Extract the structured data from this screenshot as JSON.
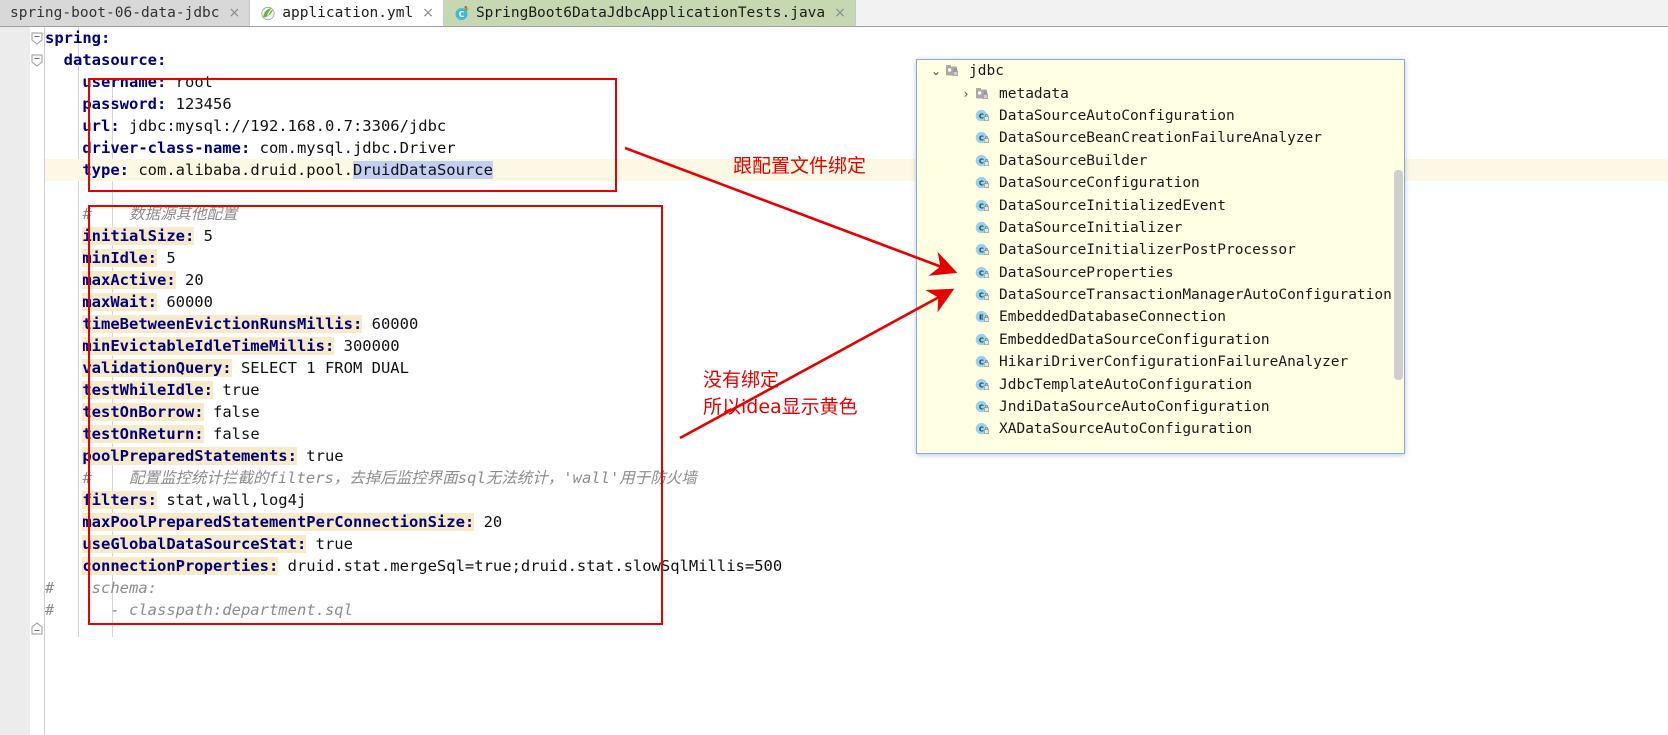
{
  "tabs": [
    {
      "label": "spring-boot-06-data-jdbc",
      "state": "inactive",
      "icon": "none",
      "close": "×"
    },
    {
      "label": "application.yml",
      "state": "plain",
      "icon": "spring-leaf-icon",
      "close": "×"
    },
    {
      "label": "SpringBoot6DataJdbcApplicationTests.java",
      "state": "active",
      "icon": "java-class-icon",
      "close": "×"
    }
  ],
  "editor": {
    "filename": "application.yml",
    "lines": [
      {
        "indent": 0,
        "key": "spring",
        "colon": ":",
        "value": "",
        "type": "key",
        "highlight": false,
        "fold": true
      },
      {
        "indent": 2,
        "key": "datasource",
        "colon": ":",
        "value": "",
        "type": "key",
        "highlight": false,
        "fold": true
      },
      {
        "indent": 4,
        "key": "username",
        "colon": ":",
        "value": " root",
        "type": "key",
        "highlight": false,
        "fold": false
      },
      {
        "indent": 4,
        "key": "password",
        "colon": ":",
        "value": " 123456",
        "type": "key",
        "highlight": false,
        "fold": false
      },
      {
        "indent": 4,
        "key": "url",
        "colon": ":",
        "value": " jdbc:mysql://192.168.0.7:3306/jdbc",
        "type": "key",
        "highlight": false,
        "fold": false
      },
      {
        "indent": 4,
        "key": "driver-class-name",
        "colon": ":",
        "value": " com.mysql.jdbc.Driver",
        "type": "key",
        "highlight": false,
        "fold": false
      },
      {
        "indent": 4,
        "key": "type",
        "colon": ":",
        "value": " com.alibaba.druid.pool.",
        "selected": "DruidDataSource",
        "type": "key",
        "highlight": false,
        "fold": false,
        "currentLine": true
      },
      {
        "indent": 0,
        "key": "",
        "colon": "",
        "value": "",
        "type": "blank",
        "highlight": false,
        "fold": false
      },
      {
        "indent": 4,
        "key": "",
        "colon": "",
        "value": "#    数据源其他配置",
        "type": "comment",
        "highlight": false,
        "fold": false
      },
      {
        "indent": 4,
        "key": "initialSize",
        "colon": ":",
        "value": " 5",
        "type": "key",
        "highlight": true,
        "fold": false
      },
      {
        "indent": 4,
        "key": "minIdle",
        "colon": ":",
        "value": " 5",
        "type": "key",
        "highlight": true,
        "fold": false
      },
      {
        "indent": 4,
        "key": "maxActive",
        "colon": ":",
        "value": " 20",
        "type": "key",
        "highlight": true,
        "fold": false
      },
      {
        "indent": 4,
        "key": "maxWait",
        "colon": ":",
        "value": " 60000",
        "type": "key",
        "highlight": true,
        "fold": false
      },
      {
        "indent": 4,
        "key": "timeBetweenEvictionRunsMillis",
        "colon": ":",
        "value": " 60000",
        "type": "key",
        "highlight": true,
        "fold": false
      },
      {
        "indent": 4,
        "key": "minEvictableIdleTimeMillis",
        "colon": ":",
        "value": " 300000",
        "type": "key",
        "highlight": true,
        "fold": false
      },
      {
        "indent": 4,
        "key": "validationQuery",
        "colon": ":",
        "value": " SELECT 1 FROM DUAL",
        "type": "key",
        "highlight": true,
        "fold": false
      },
      {
        "indent": 4,
        "key": "testWhileIdle",
        "colon": ":",
        "value": " true",
        "type": "key",
        "highlight": true,
        "fold": false
      },
      {
        "indent": 4,
        "key": "testOnBorrow",
        "colon": ":",
        "value": " false",
        "type": "key",
        "highlight": true,
        "fold": false
      },
      {
        "indent": 4,
        "key": "testOnReturn",
        "colon": ":",
        "value": " false",
        "type": "key",
        "highlight": true,
        "fold": false
      },
      {
        "indent": 4,
        "key": "poolPreparedStatements",
        "colon": ":",
        "value": " true",
        "type": "key",
        "highlight": true,
        "fold": false
      },
      {
        "indent": 4,
        "key": "",
        "colon": "",
        "value": "#    配置监控统计拦截的filters，去掉后监控界面sql无法统计，'wall'用于防火墙",
        "type": "comment",
        "highlight": false,
        "fold": false
      },
      {
        "indent": 4,
        "key": "filters",
        "colon": ":",
        "value": " stat,wall,log4j",
        "type": "key",
        "highlight": true,
        "fold": false
      },
      {
        "indent": 4,
        "key": "maxPoolPreparedStatementPerConnectionSize",
        "colon": ":",
        "value": " 20",
        "type": "key",
        "highlight": true,
        "fold": false
      },
      {
        "indent": 4,
        "key": "useGlobalDataSourceStat",
        "colon": ":",
        "value": " true",
        "type": "key",
        "highlight": true,
        "fold": false
      },
      {
        "indent": 4,
        "key": "connectionProperties",
        "colon": ":",
        "value": " druid.stat.mergeSql=true;druid.stat.slowSqlMillis=500",
        "type": "key",
        "highlight": true,
        "fold": false
      },
      {
        "indent": 0,
        "key": "",
        "colon": "",
        "value": "#    schema:",
        "type": "comment-gutter",
        "highlight": false,
        "fold": true
      },
      {
        "indent": 0,
        "key": "",
        "colon": "",
        "value": "#      - classpath:department.sql",
        "type": "comment-gutter",
        "highlight": false,
        "fold": false
      }
    ]
  },
  "annotations": {
    "boxes": [
      {
        "name": "datasource-binding-box"
      },
      {
        "name": "unbound-properties-box"
      },
      {
        "name": "datasource-properties-box"
      }
    ],
    "texts": [
      {
        "name": "binding-note",
        "lines": [
          "跟配置文件绑定"
        ]
      },
      {
        "name": "unbound-note",
        "lines": [
          "没有绑定",
          "所以idea显示黄色"
        ]
      }
    ],
    "color": "#e60000"
  },
  "popup": {
    "title": "jdbc-package-tree",
    "items": [
      {
        "label": "jdbc",
        "icon": "package-icon",
        "twist": "expanded",
        "depth": 0,
        "boxed": false
      },
      {
        "label": "metadata",
        "icon": "package-icon",
        "twist": "collapsed",
        "depth": 1,
        "boxed": false
      },
      {
        "label": "DataSourceAutoConfiguration",
        "icon": "class-icon",
        "twist": "none",
        "depth": 1,
        "boxed": false
      },
      {
        "label": "DataSourceBeanCreationFailureAnalyzer",
        "icon": "class-icon",
        "twist": "none",
        "depth": 1,
        "boxed": false
      },
      {
        "label": "DataSourceBuilder",
        "icon": "class-icon",
        "twist": "none",
        "depth": 1,
        "boxed": false
      },
      {
        "label": "DataSourceConfiguration",
        "icon": "class-icon",
        "twist": "none",
        "depth": 1,
        "boxed": false
      },
      {
        "label": "DataSourceInitializedEvent",
        "icon": "class-icon",
        "twist": "none",
        "depth": 1,
        "boxed": false
      },
      {
        "label": "DataSourceInitializer",
        "icon": "class-icon",
        "twist": "none",
        "depth": 1,
        "boxed": false
      },
      {
        "label": "DataSourceInitializerPostProcessor",
        "icon": "class-icon",
        "twist": "none",
        "depth": 1,
        "boxed": false
      },
      {
        "label": "DataSourceProperties",
        "icon": "class-icon",
        "twist": "none",
        "depth": 1,
        "boxed": true
      },
      {
        "label": "DataSourceTransactionManagerAutoConfiguration",
        "icon": "class-icon",
        "twist": "none",
        "depth": 1,
        "boxed": false
      },
      {
        "label": "EmbeddedDatabaseConnection",
        "icon": "enum-icon",
        "twist": "none",
        "depth": 1,
        "boxed": false
      },
      {
        "label": "EmbeddedDataSourceConfiguration",
        "icon": "class-icon",
        "twist": "none",
        "depth": 1,
        "boxed": false
      },
      {
        "label": "HikariDriverConfigurationFailureAnalyzer",
        "icon": "class-icon",
        "twist": "none",
        "depth": 1,
        "boxed": false
      },
      {
        "label": "JdbcTemplateAutoConfiguration",
        "icon": "class-icon",
        "twist": "none",
        "depth": 1,
        "boxed": false
      },
      {
        "label": "JndiDataSourceAutoConfiguration",
        "icon": "class-icon",
        "twist": "none",
        "depth": 1,
        "boxed": false
      },
      {
        "label": "XADataSourceAutoConfiguration",
        "icon": "class-icon",
        "twist": "none",
        "depth": 1,
        "boxed": false
      }
    ],
    "twist_glyphs": {
      "expanded": "⌄",
      "collapsed": "›",
      "none": ""
    }
  },
  "colors": {
    "key": "#000080",
    "value": "#111111",
    "comment": "#8c8c8c",
    "unbound_highlight": "#f7eac8",
    "selection": "#c3cff0",
    "annotation_red": "#e60000",
    "popup_bg": "#ffffe4",
    "popup_border": "#8aa9d6",
    "active_tab_bg": "#c6d8b2",
    "current_line_bg": "#fdf8e3"
  }
}
